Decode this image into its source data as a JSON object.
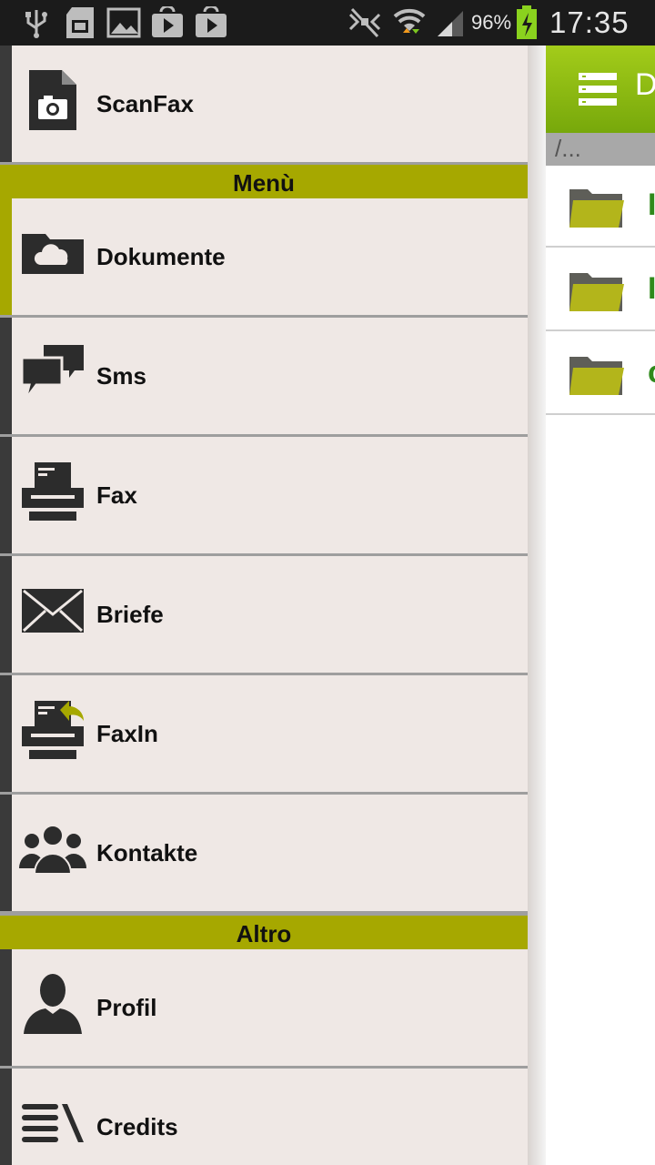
{
  "status_bar": {
    "battery_percent": "96%",
    "time": "17:35",
    "icons": [
      "usb-icon",
      "sd-card-icon",
      "image-icon",
      "play-store-icon",
      "play-store-icon",
      "no-signal-icon",
      "wifi-icon",
      "cell-signal-icon",
      "battery-charging-icon"
    ]
  },
  "background_screen": {
    "header_title_fragment": "D",
    "path": "/...",
    "folder_fragments": [
      "I",
      "I",
      "c"
    ]
  },
  "drawer": {
    "app": {
      "label": "ScanFax",
      "icon": "scanfax-camera-icon"
    },
    "section_menu": "Menù",
    "menu_items": [
      {
        "label": "Dokumente",
        "icon": "cloud-folder-icon"
      },
      {
        "label": "Sms",
        "icon": "chat-bubbles-icon"
      },
      {
        "label": "Fax",
        "icon": "fax-machine-icon"
      },
      {
        "label": "Briefe",
        "icon": "envelope-icon"
      },
      {
        "label": "FaxIn",
        "icon": "fax-incoming-icon"
      },
      {
        "label": "Kontakte",
        "icon": "contacts-group-icon"
      }
    ],
    "section_other": "Altro",
    "other_items": [
      {
        "label": "Profil",
        "icon": "user-profile-icon"
      },
      {
        "label": "Credits",
        "icon": "credits-list-icon"
      }
    ]
  },
  "colors": {
    "accent": "#a6a800",
    "drawer_bg": "#efe8e5",
    "header_green": "#8dbb12",
    "folder_text": "#2f8a1b"
  }
}
